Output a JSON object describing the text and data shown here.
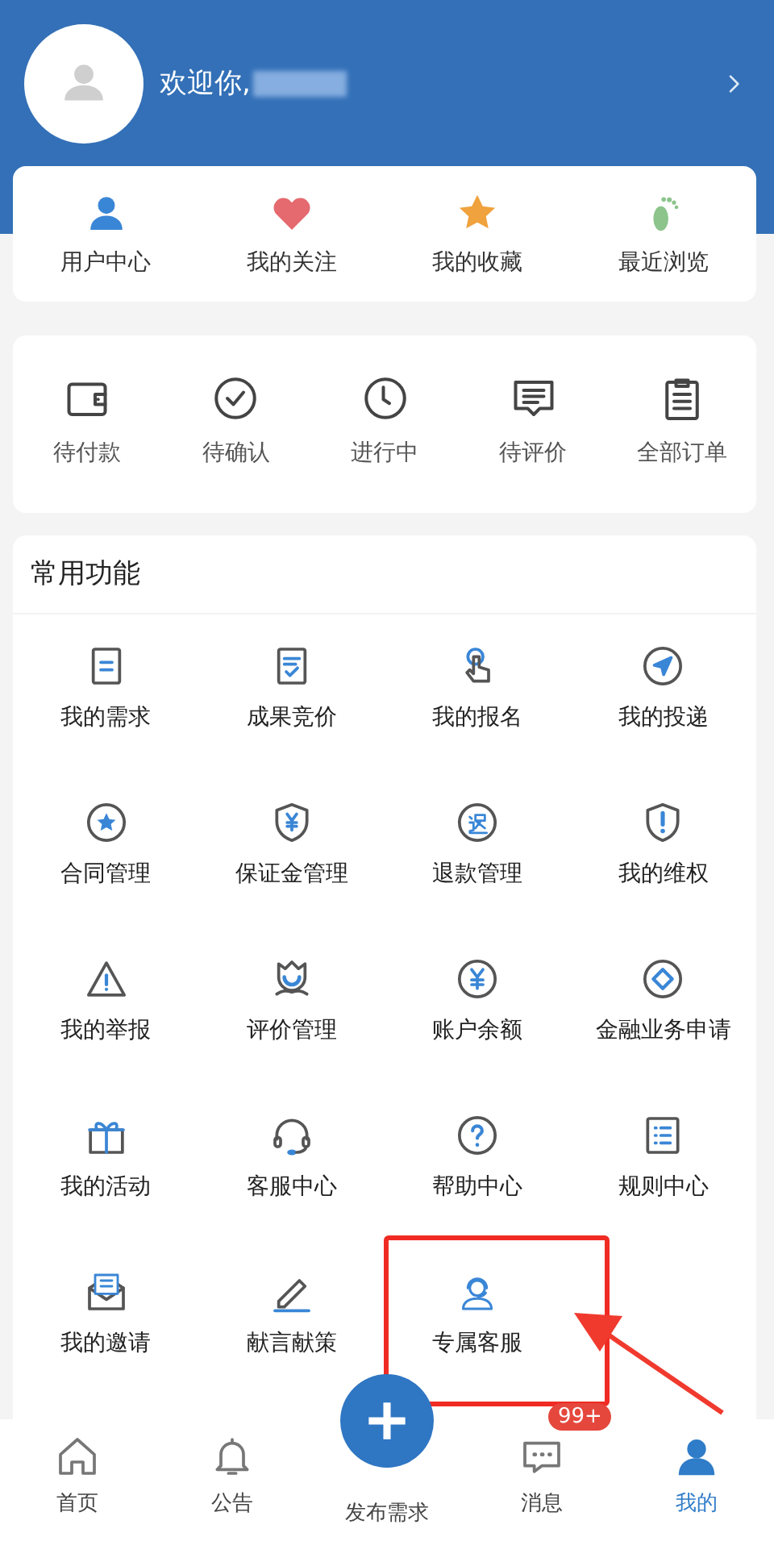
{
  "profile": {
    "greeting": "欢迎你,"
  },
  "quick_links": [
    {
      "label": "用户中心"
    },
    {
      "label": "我的关注"
    },
    {
      "label": "我的收藏"
    },
    {
      "label": "最近浏览"
    }
  ],
  "orders": [
    {
      "label": "待付款"
    },
    {
      "label": "待确认"
    },
    {
      "label": "进行中"
    },
    {
      "label": "待评价"
    },
    {
      "label": "全部订单"
    }
  ],
  "functions": {
    "title": "常用功能",
    "items": [
      {
        "label": "我的需求"
      },
      {
        "label": "成果竞价"
      },
      {
        "label": "我的报名"
      },
      {
        "label": "我的投递"
      },
      {
        "label": "合同管理"
      },
      {
        "label": "保证金管理"
      },
      {
        "label": "退款管理"
      },
      {
        "label": "我的维权"
      },
      {
        "label": "我的举报"
      },
      {
        "label": "评价管理"
      },
      {
        "label": "账户余额"
      },
      {
        "label": "金融业务申请"
      },
      {
        "label": "我的活动"
      },
      {
        "label": "客服中心"
      },
      {
        "label": "帮助中心"
      },
      {
        "label": "规则中心"
      },
      {
        "label": "我的邀请"
      },
      {
        "label": "献言献策"
      },
      {
        "label": "专属客服",
        "highlighted": true
      }
    ]
  },
  "tab_bar": [
    {
      "label": "首页",
      "selected": false
    },
    {
      "label": "公告",
      "selected": false
    },
    {
      "label": "发布需求",
      "kind": "publish",
      "selected": false
    },
    {
      "label": "消息",
      "badge": "99+",
      "selected": false
    },
    {
      "label": "我的",
      "selected": true
    }
  ]
}
